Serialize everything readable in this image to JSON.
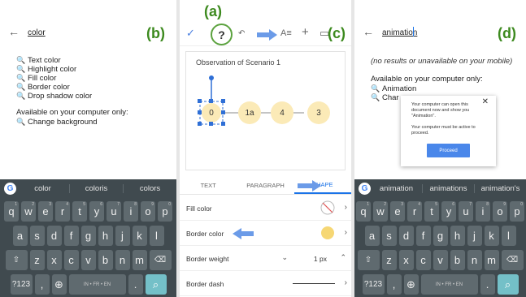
{
  "letters": {
    "a": "(a)",
    "b": "(b)",
    "c": "(c)",
    "d": "(d)"
  },
  "panel_b": {
    "query": "color",
    "results": [
      "Text color",
      "Highlight color",
      "Fill color",
      "Border color",
      "Drop shadow color"
    ],
    "computer_header": "Available on your computer only:",
    "computer_results": [
      "Change background"
    ],
    "suggestions": [
      "color",
      "coloris",
      "colors"
    ]
  },
  "panel_c": {
    "doc_title": "Observation of Scenario 1",
    "nodes": [
      "0",
      "1a",
      "4",
      "3"
    ],
    "tabs": [
      "TEXT",
      "PARAGRAPH",
      "SHAPE"
    ],
    "props": [
      "Fill color",
      "Border color",
      "Border weight",
      "Border dash"
    ],
    "border_weight_value": "1 px",
    "help_label": "?",
    "text_format_label": "A≡",
    "undo_label": "↶"
  },
  "panel_d": {
    "query": "animation",
    "no_results": "(no results or unavailable on your mobile)",
    "computer_header": "Available on your computer only:",
    "results": [
      "Animation",
      "Char"
    ],
    "dialog_line1": "Your computer can open this document now and show you \"Animation\".",
    "dialog_line2": "Your computer must be active to proceed.",
    "proceed_label": "Proceed",
    "suggestions": [
      "animation",
      "animations",
      "animation's"
    ]
  },
  "keyboard": {
    "row1": [
      "q",
      "w",
      "e",
      "r",
      "t",
      "y",
      "u",
      "i",
      "o",
      "p"
    ],
    "row1_digits": [
      "1",
      "2",
      "3",
      "4",
      "5",
      "6",
      "7",
      "8",
      "9",
      "0"
    ],
    "row2": [
      "a",
      "s",
      "d",
      "f",
      "g",
      "h",
      "j",
      "k",
      "l"
    ],
    "row3": [
      "z",
      "x",
      "c",
      "v",
      "b",
      "n",
      "m"
    ],
    "mode_label": "?123",
    "space_label": "IN • FR • EN",
    "period_label": "."
  },
  "colors": {
    "accent_green": "#3d8a1f",
    "accent_blue": "#1a73e8",
    "node_fill": "#fbeab7",
    "keyboard_bg": "#404a4f"
  }
}
